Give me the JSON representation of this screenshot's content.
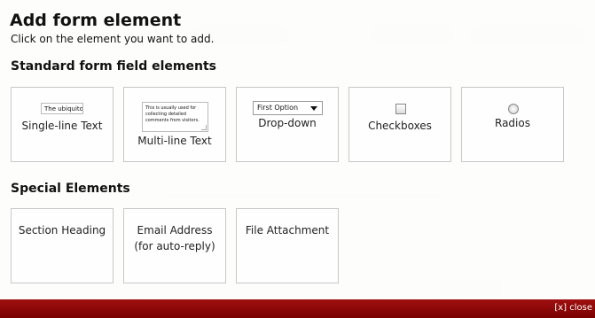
{
  "dialog": {
    "title": "Add form element",
    "subtitle": "Click on the element you want to add."
  },
  "standard": {
    "heading": "Standard form field elements",
    "items": [
      {
        "label": "Single-line Text",
        "preview": "The ubiquitous"
      },
      {
        "label": "Multi-line Text",
        "preview": "This is usually used for collecting detailed comments from visitors."
      },
      {
        "label": "Drop-down",
        "preview": "First Option"
      },
      {
        "label": "Checkboxes"
      },
      {
        "label": "Radios"
      }
    ]
  },
  "special": {
    "heading": "Special Elements",
    "items": [
      {
        "label": "Section Heading"
      },
      {
        "label_line1": "Email Address",
        "label_line2": "(for auto-reply)"
      },
      {
        "label": "File Attachment"
      }
    ]
  },
  "footer": {
    "close_label": "[x] close"
  },
  "colors": {
    "footer": "#8b0000",
    "tile_border": "#c8c8c8"
  }
}
